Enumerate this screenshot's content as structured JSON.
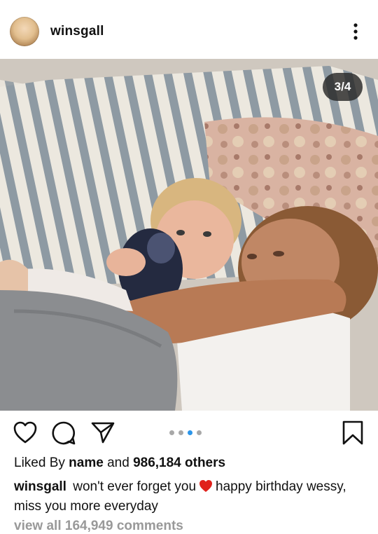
{
  "header": {
    "username": "winsgall"
  },
  "post": {
    "photo_counter": "3/4",
    "carousel": {
      "total_dots": 4,
      "active_index": 2
    }
  },
  "likes": {
    "prefix": "Liked By",
    "name": "name",
    "connector": "and",
    "count": "986,184 others"
  },
  "caption": {
    "user": "winsgall",
    "text_before": "won't ever forget you",
    "text_after": "happy birthday wessy, miss you more everyday"
  },
  "comments": {
    "label": "view all 164,949 comments"
  },
  "colors": {
    "accent_dot": "#2b95e9",
    "heart_emoji": "#e0211b",
    "muted_text": "#999999"
  }
}
